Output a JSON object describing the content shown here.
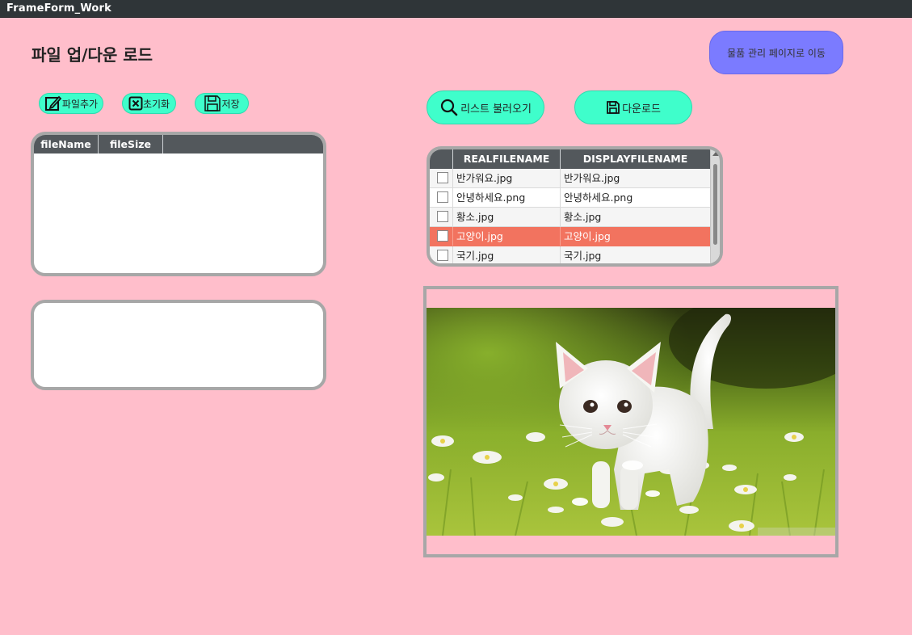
{
  "window": {
    "title": "FrameForm_Work"
  },
  "page": {
    "title": "파일 업/다운 로드"
  },
  "nav": {
    "goods_page_label": "물품 관리 페이지로 이동"
  },
  "upload_toolbar": {
    "add_label": "파일추가",
    "reset_label": "초기화",
    "save_label": "저장"
  },
  "download_toolbar": {
    "load_list_label": "리스트 불러오기",
    "download_label": "다운로드"
  },
  "upload_grid": {
    "columns": [
      "fileName",
      "fileSize"
    ],
    "rows": []
  },
  "file_list_grid": {
    "columns": [
      "REALFILENAME",
      "DISPLAYFILENAME"
    ],
    "rows": [
      {
        "real": "반가워요.jpg",
        "display": "반가워요.jpg",
        "checked": false,
        "selected": false
      },
      {
        "real": "안녕하세요.png",
        "display": "안녕하세요.png",
        "checked": false,
        "selected": false
      },
      {
        "real": "황소.jpg",
        "display": "황소.jpg",
        "checked": false,
        "selected": false
      },
      {
        "real": "고양이.jpg",
        "display": "고양이.jpg",
        "checked": false,
        "selected": true
      },
      {
        "real": "국기.jpg",
        "display": "국기.jpg",
        "checked": false,
        "selected": false
      }
    ]
  },
  "preview": {
    "subject": "white kitten walking in grass"
  },
  "colors": {
    "background": "#ffbecb",
    "titlebar": "#2f3538",
    "nav_button": "#7b7bff",
    "action_button": "#3ffecb",
    "grid_header": "#53585c",
    "selected_row": "#f2735f",
    "panel_border": "#a7a7a7"
  },
  "icons": {
    "add": "edit-icon",
    "reset": "close-box-icon",
    "save": "floppy-icon",
    "load_list": "search-icon",
    "download": "floppy-icon"
  }
}
